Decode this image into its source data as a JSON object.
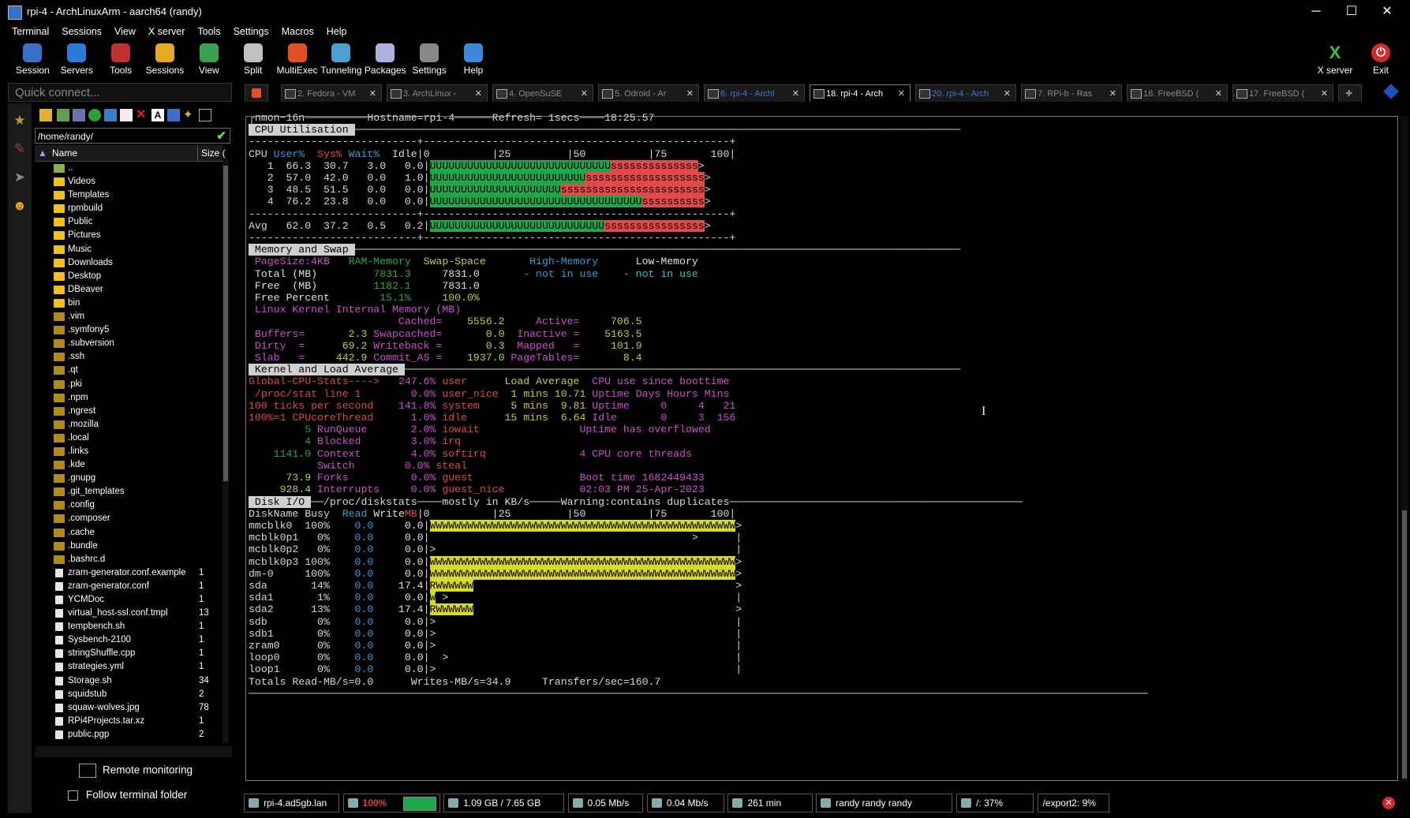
{
  "window": {
    "title": "rpi-4 - ArchLinuxArm - aarch64 (randy)",
    "controls": [
      "─",
      "☐",
      "✕"
    ]
  },
  "menu": [
    "Terminal",
    "Sessions",
    "View",
    "X server",
    "Tools",
    "Settings",
    "Macros",
    "Help"
  ],
  "toolbar": {
    "buttons": [
      {
        "label": "Session",
        "icon": "session-icon",
        "color": "#3a6ec8"
      },
      {
        "label": "Servers",
        "icon": "servers-icon",
        "color": "#2a7bd6"
      },
      {
        "label": "Tools",
        "icon": "tools-icon",
        "color": "#c03030"
      },
      {
        "label": "Sessions",
        "icon": "star-icon",
        "color": "#e8a820"
      },
      {
        "label": "View",
        "icon": "view-icon",
        "color": "#3aa050"
      },
      {
        "label": "Split",
        "icon": "split-icon",
        "color": "#c0c0c0"
      },
      {
        "label": "MultiExec",
        "icon": "multiexec-icon",
        "color": "#e05020"
      },
      {
        "label": "Tunneling",
        "icon": "tunneling-icon",
        "color": "#4aa0d0"
      },
      {
        "label": "Packages",
        "icon": "packages-icon",
        "color": "#b0b0e0"
      },
      {
        "label": "Settings",
        "icon": "settings-icon",
        "color": "#888888"
      },
      {
        "label": "Help",
        "icon": "help-icon",
        "color": "#3a8ad8"
      }
    ],
    "xserver_label": "X server",
    "exit_label": "Exit"
  },
  "quick_connect": {
    "placeholder": "Quick connect..."
  },
  "tabs": [
    {
      "label": "2. Fedora - VM",
      "state": "normal"
    },
    {
      "label": "3. ArchLinux -",
      "state": "normal"
    },
    {
      "label": "4. OpenSuSE",
      "state": "normal"
    },
    {
      "label": "5. Odroid - Ar",
      "state": "normal"
    },
    {
      "label": "6. rpi-4 - Archl",
      "state": "blue"
    },
    {
      "label": "18. rpi-4 - Arch",
      "state": "active"
    },
    {
      "label": "20. rpi-4 - Arch",
      "state": "blue"
    },
    {
      "label": "7. RPi-b - Ras",
      "state": "normal"
    },
    {
      "label": "16. FreeBSD (",
      "state": "normal"
    },
    {
      "label": "17. FreeBSD (",
      "state": "normal"
    }
  ],
  "file_browser": {
    "path": "/home/randy/",
    "col_name": "Name",
    "col_size": "Size (",
    "files": [
      {
        "name": "..",
        "size": "",
        "kind": "up"
      },
      {
        "name": "Videos",
        "size": "",
        "kind": "folder"
      },
      {
        "name": "Templates",
        "size": "",
        "kind": "folder"
      },
      {
        "name": "rpmbuild",
        "size": "",
        "kind": "folder"
      },
      {
        "name": "Public",
        "size": "",
        "kind": "folder"
      },
      {
        "name": "Pictures",
        "size": "",
        "kind": "folder"
      },
      {
        "name": "Music",
        "size": "",
        "kind": "folder"
      },
      {
        "name": "Downloads",
        "size": "",
        "kind": "folder"
      },
      {
        "name": "Desktop",
        "size": "",
        "kind": "folder"
      },
      {
        "name": "DBeaver",
        "size": "",
        "kind": "folder"
      },
      {
        "name": "bin",
        "size": "",
        "kind": "folder"
      },
      {
        "name": ".vim",
        "size": "",
        "kind": "hidden"
      },
      {
        "name": ".symfony5",
        "size": "",
        "kind": "hidden"
      },
      {
        "name": ".subversion",
        "size": "",
        "kind": "hidden"
      },
      {
        "name": ".ssh",
        "size": "",
        "kind": "hidden"
      },
      {
        "name": ".qt",
        "size": "",
        "kind": "hidden"
      },
      {
        "name": ".pki",
        "size": "",
        "kind": "hidden"
      },
      {
        "name": ".npm",
        "size": "",
        "kind": "hidden"
      },
      {
        "name": ".ngrest",
        "size": "",
        "kind": "hidden"
      },
      {
        "name": ".mozilla",
        "size": "",
        "kind": "hidden"
      },
      {
        "name": ".local",
        "size": "",
        "kind": "hidden"
      },
      {
        "name": ".links",
        "size": "",
        "kind": "hidden"
      },
      {
        "name": ".kde",
        "size": "",
        "kind": "hidden"
      },
      {
        "name": ".gnupg",
        "size": "",
        "kind": "hidden"
      },
      {
        "name": ".git_templates",
        "size": "",
        "kind": "hidden"
      },
      {
        "name": ".config",
        "size": "",
        "kind": "hidden"
      },
      {
        "name": ".composer",
        "size": "",
        "kind": "hidden"
      },
      {
        "name": ".cache",
        "size": "",
        "kind": "hidden"
      },
      {
        "name": ".bundle",
        "size": "",
        "kind": "hidden"
      },
      {
        "name": ".bashrc.d",
        "size": "",
        "kind": "hidden"
      },
      {
        "name": "zram-generator.conf.example",
        "size": "1",
        "kind": "file"
      },
      {
        "name": "zram-generator.conf",
        "size": "1",
        "kind": "file"
      },
      {
        "name": "YCMDoc",
        "size": "1",
        "kind": "file"
      },
      {
        "name": "virtual_host-ssl.conf.tmpl",
        "size": "13",
        "kind": "file"
      },
      {
        "name": "tempbench.sh",
        "size": "1",
        "kind": "file"
      },
      {
        "name": "Sysbench-2100",
        "size": "1",
        "kind": "file"
      },
      {
        "name": "stringShuffle.cpp",
        "size": "1",
        "kind": "file"
      },
      {
        "name": "strategies.yml",
        "size": "1",
        "kind": "file"
      },
      {
        "name": "Storage.sh",
        "size": "34",
        "kind": "file"
      },
      {
        "name": "squidstub",
        "size": "2",
        "kind": "file"
      },
      {
        "name": "squaw-wolves.jpg",
        "size": "78",
        "kind": "file"
      },
      {
        "name": "RPi4Projects.tar.xz",
        "size": "1",
        "kind": "file"
      },
      {
        "name": "public.pgp",
        "size": "2",
        "kind": "file"
      }
    ],
    "remote_monitoring": "Remote monitoring",
    "follow_folder": "Follow terminal folder"
  },
  "nmon": {
    "header": "nmon−16n",
    "hostname": "Hostname=rpi-4",
    "refresh": "Refresh= 1secs",
    "time": "18:25.57",
    "cpu": [
      {
        "cpu": "1",
        "user": "66.3",
        "sys": "30.7",
        "wait": "3.0",
        "idle": "0.0",
        "u_chars": 29,
        "s_chars": 14
      },
      {
        "cpu": "2",
        "user": "57.0",
        "sys": "42.0",
        "wait": "0.0",
        "idle": "1.0",
        "u_chars": 25,
        "s_chars": 19
      },
      {
        "cpu": "3",
        "user": "48.5",
        "sys": "51.5",
        "wait": "0.0",
        "idle": "0.0",
        "u_chars": 21,
        "s_chars": 23
      },
      {
        "cpu": "4",
        "user": "76.2",
        "sys": "23.8",
        "wait": "0.0",
        "idle": "0.0",
        "u_chars": 34,
        "s_chars": 10
      }
    ],
    "cpu_avg": {
      "user": "62.0",
      "sys": "37.2",
      "wait": "0.5",
      "idle": "0.2",
      "u_chars": 28,
      "s_chars": 16
    },
    "memory": {
      "total_ram": "7831.3",
      "total_swap": "7831.0",
      "free_ram": "1182.1",
      "free_swap": "7831.0",
      "freepct_ram": "15.1%",
      "freepct_swap": "100.0%",
      "cached": "5556.2",
      "active": "706.5",
      "buffers": "2.3",
      "swapcached": "0.0",
      "inactive": "5163.5",
      "dirty": "69.2",
      "writeback": "0.3",
      "mapped": "101.9",
      "slab": "442.9",
      "commit_as": "1937.0",
      "pagetables": "8.4"
    },
    "kernel": {
      "user": "247.6%",
      "user_nice": "0.0%",
      "system": "141.8%",
      "idle": "1.0%",
      "iowait": "2.0%",
      "irq": "3.0%",
      "softirq": "4.0%",
      "steal": "0.0%",
      "guest": "0.0%",
      "guest_nice": "0.0%",
      "runqueue": "5",
      "blocked": "4",
      "context": "1141.0",
      "forks": "73.9",
      "interrupts": "928.4",
      "load1": "10.71",
      "load5": "9.81",
      "load15": "6.64",
      "boot_time": "1682449433",
      "boot_date": "02:03 PM 25-Apr-2023"
    },
    "disks": [
      {
        "name": "mmcblk0",
        "busy": "100%",
        "read": "0.0",
        "write": "0.0",
        "bar": "full"
      },
      {
        "name": "mcblk0p1",
        "busy": "0%",
        "read": "0.0",
        "write": "0.0",
        "bar": "none1"
      },
      {
        "name": "mcblk0p2",
        "busy": "0%",
        "read": "0.0",
        "write": "0.0",
        "bar": "zero"
      },
      {
        "name": "mcblk0p3",
        "busy": "100%",
        "read": "0.0",
        "write": "0.0",
        "bar": "full"
      },
      {
        "name": "dm-0",
        "busy": "100%",
        "read": "0.0",
        "write": "0.0",
        "bar": "full"
      },
      {
        "name": "sda",
        "busy": "14%",
        "read": "0.0",
        "write": "17.4",
        "bar": "small"
      },
      {
        "name": "sda1",
        "busy": "1%",
        "read": "0.0",
        "write": "0.0",
        "bar": "tiny"
      },
      {
        "name": "sda2",
        "busy": "13%",
        "read": "0.0",
        "write": "17.4",
        "bar": "small2"
      },
      {
        "name": "sdb",
        "busy": "0%",
        "read": "0.0",
        "write": "0.0",
        "bar": "zero"
      },
      {
        "name": "sdb1",
        "busy": "0%",
        "read": "0.0",
        "write": "0.0",
        "bar": "zero"
      },
      {
        "name": "zram0",
        "busy": "0%",
        "read": "0.0",
        "write": "0.0",
        "bar": "zero"
      },
      {
        "name": "loop0",
        "busy": "0%",
        "read": "0.0",
        "write": "0.0",
        "bar": "zero2"
      },
      {
        "name": "loop1",
        "busy": "0%",
        "read": "0.0",
        "write": "0.0",
        "bar": "zero"
      }
    ],
    "totals": "Totals Read-MB/s=0.0      Writes-MB/s=34.9     Transfers/sec=160.7"
  },
  "statusbar": [
    {
      "label": "rpi-4.ad5gb.lan",
      "icon": "host-icon"
    },
    {
      "label": "100%",
      "icon": "cpu-icon"
    },
    {
      "label": "1.09 GB / 7.65 GB",
      "icon": "memory-icon"
    },
    {
      "label": "0.05 Mb/s",
      "icon": "upload-icon"
    },
    {
      "label": "0.04 Mb/s",
      "icon": "download-icon"
    },
    {
      "label": "261 min",
      "icon": "uptime-icon"
    },
    {
      "label": "randy  randy  randy",
      "icon": "user-icon"
    },
    {
      "label": "/: 37%",
      "icon": "disk-icon"
    },
    {
      "label": "/export2: 9%",
      "icon": ""
    }
  ],
  "colors": {
    "user": "#1fa54a",
    "sys": "#e24a4a",
    "disk": "#d9d92a"
  }
}
